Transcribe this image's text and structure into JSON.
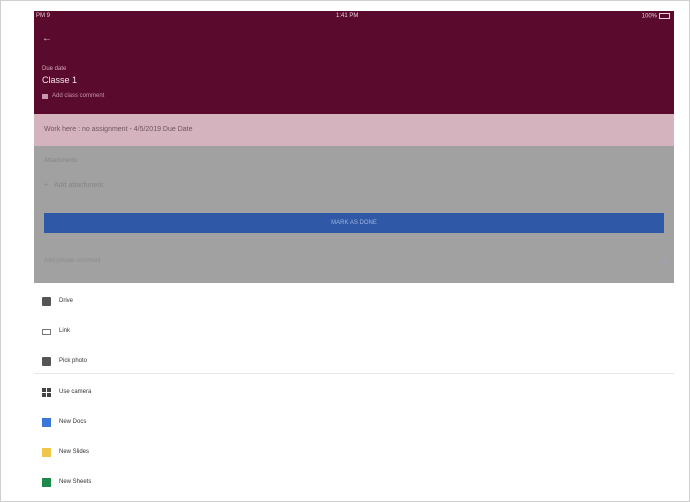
{
  "status_bar": {
    "left": "PM 9",
    "center": "1:41 PM",
    "right": "100%"
  },
  "header": {
    "back_icon": "back-arrow-icon",
    "label": "Due date",
    "title": "Classe 1",
    "subtitle": "Add class comment"
  },
  "banner": {
    "text": "Work here : no assignment - 4/5/2019 Due Date"
  },
  "attachments": {
    "label": "Attachments",
    "add_label": "Add attachment"
  },
  "primary_button": {
    "label": "MARK AS DONE"
  },
  "comment": {
    "placeholder": "Add private comment",
    "send_icon": "send-icon"
  },
  "sheet": {
    "items": [
      {
        "label": "Drive",
        "icon": "drive-icon"
      },
      {
        "label": "Link",
        "icon": "link-icon"
      },
      {
        "label": "Pick photo",
        "icon": "photo-icon"
      },
      {
        "label": "Use camera",
        "icon": "camera-icon"
      },
      {
        "label": "New Docs",
        "icon": "docs-icon"
      },
      {
        "label": "New Slides",
        "icon": "slides-icon"
      },
      {
        "label": "New Sheets",
        "icon": "sheets-icon"
      }
    ]
  },
  "colors": {
    "header": "#5a0a2c",
    "banner": "#d4b3bf",
    "primary": "#2f58a6",
    "docs": "#3b77d8",
    "slides": "#f2c64b",
    "sheets": "#1d8a4b"
  }
}
